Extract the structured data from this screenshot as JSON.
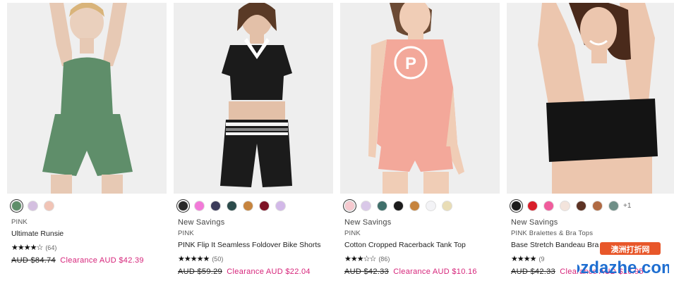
{
  "products": [
    {
      "swatches": [
        "#5f8e6a",
        "#d4bfe0",
        "#f1c4b6"
      ],
      "selected_swatch": 0,
      "more": "",
      "tag": "",
      "brand": "PINK",
      "title": "Ultimate Runsie",
      "rating": 4.5,
      "stars": "★★★★☆",
      "review_count": "(64)",
      "old_price": "AUD $84.74",
      "sale_price": "Clearance AUD $42.39"
    },
    {
      "swatches": [
        "#2a2a2a",
        "#f27ad8",
        "#3b3b5a",
        "#2c4b4b",
        "#c6843e",
        "#7d1326",
        "#d2b8e8"
      ],
      "selected_swatch": 0,
      "more": "",
      "tag": "New Savings",
      "brand": "PINK",
      "title": "PINK Flip It Seamless Foldover Bike Shorts",
      "rating": 4.5,
      "stars": "★★★★★",
      "review_count": "(50)",
      "old_price": "AUD $59.29",
      "sale_price": "Clearance AUD $22.04"
    },
    {
      "swatches": [
        "#f6c9cf",
        "#d9c8e8",
        "#3f6f6a",
        "#1c1c1c",
        "#c6843e",
        "#f3f3f6",
        "#e9ddb6"
      ],
      "selected_swatch": 0,
      "more": "",
      "tag": "New Savings",
      "brand": "PINK",
      "title": "Cotton Cropped Racerback Tank Top",
      "rating": 3.5,
      "stars": "★★★☆☆",
      "review_count": "(86)",
      "old_price": "AUD $42.33",
      "sale_price": "Clearance AUD $10.16"
    },
    {
      "swatches": [
        "#1b1b1b",
        "#d81e2a",
        "#f05c9c",
        "#f3e4dc",
        "#5d3324",
        "#b06a43",
        "#6f8f87"
      ],
      "selected_swatch": 0,
      "more": "+1",
      "tag": "New Savings",
      "brand": "PINK Bralettes & Bra Tops",
      "title": "Base Stretch Bandeau Bra",
      "rating": 4,
      "stars": "★★★★",
      "review_count": "(9",
      "old_price": "AUD $42.33",
      "sale_price": "Clearance AUD $16.95"
    }
  ],
  "watermark": {
    "top": "澳洲打折网",
    "bottom": "ozdazhe.com"
  }
}
